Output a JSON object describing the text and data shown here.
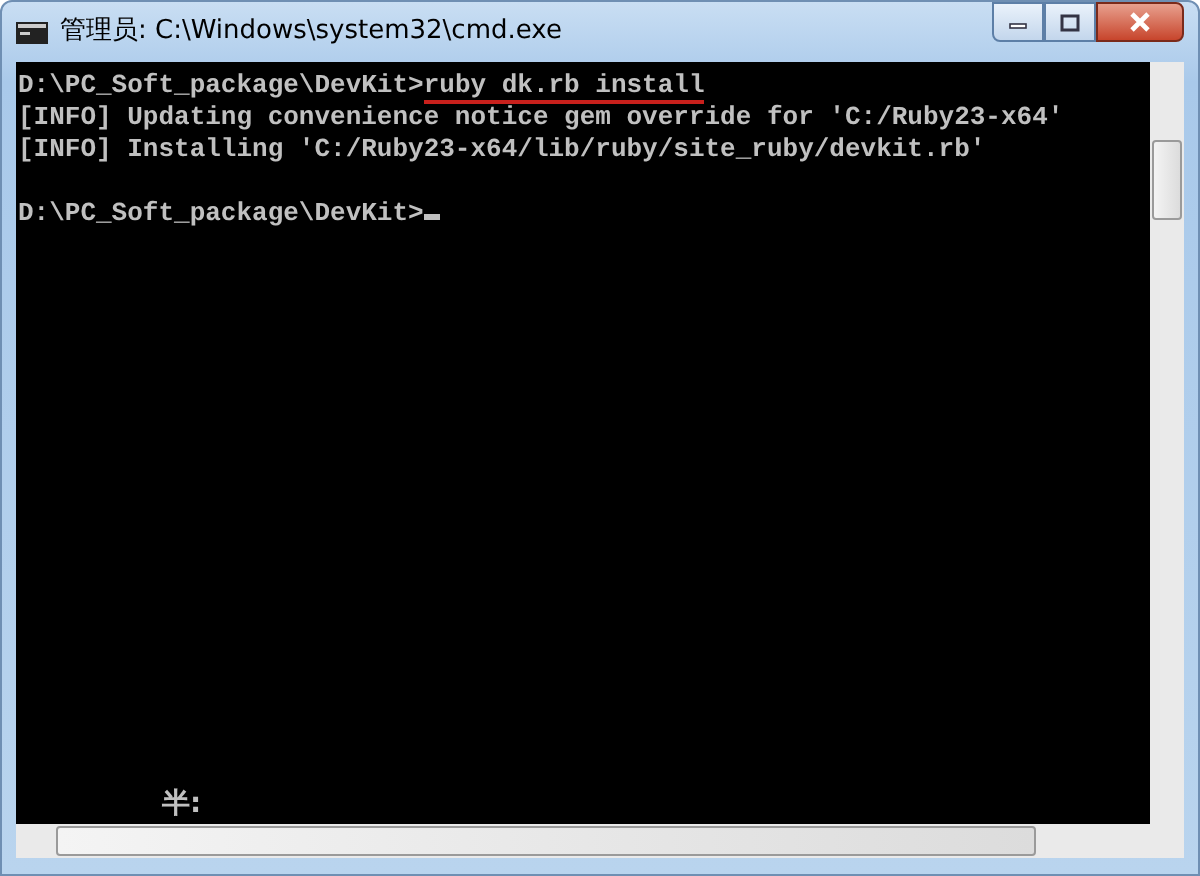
{
  "window": {
    "title": "管理员: C:\\Windows\\system32\\cmd.exe"
  },
  "console": {
    "lines": [
      {
        "kind": "command",
        "prompt": "D:\\PC_Soft_package\\DevKit>",
        "command": "ruby dk.rb install"
      },
      {
        "kind": "output",
        "text": "[INFO] Updating convenience notice gem override for 'C:/Ruby23-x64'"
      },
      {
        "kind": "output",
        "text": "[INFO] Installing 'C:/Ruby23-x64/lib/ruby/site_ruby/devkit.rb'"
      },
      {
        "kind": "blank"
      },
      {
        "kind": "command",
        "prompt": "D:\\PC_Soft_package\\DevKit>",
        "cursor": true
      }
    ],
    "ime_status": "半:"
  }
}
